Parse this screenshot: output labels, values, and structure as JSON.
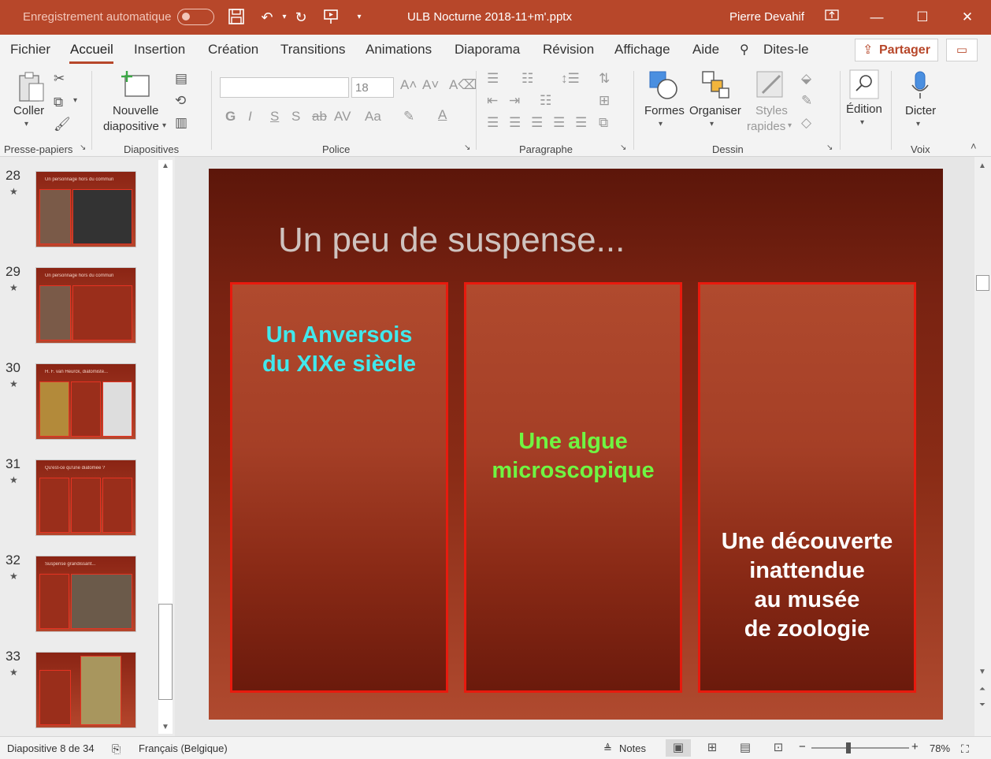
{
  "titlebar": {
    "autosave_label": "Enregistrement automatique",
    "autosave_state": "off",
    "document_title": "ULB Nocturne 2018-11+m'.pptx",
    "user_name": "Pierre Devahif",
    "accent_color": "#b7472a"
  },
  "tabs": [
    {
      "label": "Fichier"
    },
    {
      "label": "Accueil",
      "active": true
    },
    {
      "label": "Insertion"
    },
    {
      "label": "Création"
    },
    {
      "label": "Transitions"
    },
    {
      "label": "Animations"
    },
    {
      "label": "Diaporama"
    },
    {
      "label": "Révision"
    },
    {
      "label": "Affichage"
    },
    {
      "label": "Aide"
    }
  ],
  "tell_me": "Dites-le",
  "share_label": "Partager",
  "ribbon": {
    "clipboard": {
      "paste_label": "Coller",
      "group_label": "Presse-papiers"
    },
    "slides": {
      "new_slide_label_1": "Nouvelle",
      "new_slide_label_2": "diapositive",
      "group_label": "Diapositives"
    },
    "font": {
      "font_name": "",
      "font_size": "18",
      "group_label": "Police"
    },
    "paragraph": {
      "group_label": "Paragraphe"
    },
    "drawing": {
      "shapes_label": "Formes",
      "arrange_label": "Organiser",
      "styles_label_1": "Styles",
      "styles_label_2": "rapides",
      "group_label": "Dessin"
    },
    "editing": {
      "label": "Édition"
    },
    "voice": {
      "dictate_label": "Dicter",
      "group_label": "Voix"
    }
  },
  "thumbnails": [
    {
      "number": "28",
      "title": "Un personnage hors du commun"
    },
    {
      "number": "29",
      "title": "Un personnage hors du commun"
    },
    {
      "number": "30",
      "title": "H. F. van Heurck, diatomiste..."
    },
    {
      "number": "31",
      "title": "Qu'est-ce qu'une diatomée ?"
    },
    {
      "number": "32",
      "title": "Suspense grandissant..."
    },
    {
      "number": "33",
      "title": ""
    }
  ],
  "slide": {
    "title": "Un peu de suspense...",
    "panels": [
      {
        "line1": "Un Anversois",
        "line2": "du XIXe siècle",
        "color": "#41e8ec"
      },
      {
        "line1": "Une algue",
        "line2": "microscopique",
        "color": "#6ff542"
      },
      {
        "line1": "Une découverte",
        "line2": "inattendue",
        "line3": "au musée",
        "line4": "de zoologie",
        "color": "#ffffff"
      }
    ]
  },
  "status": {
    "slide_info": "Diapositive 8 de 34",
    "language": "Français (Belgique)",
    "notes_label": "Notes",
    "zoom": "78%"
  }
}
